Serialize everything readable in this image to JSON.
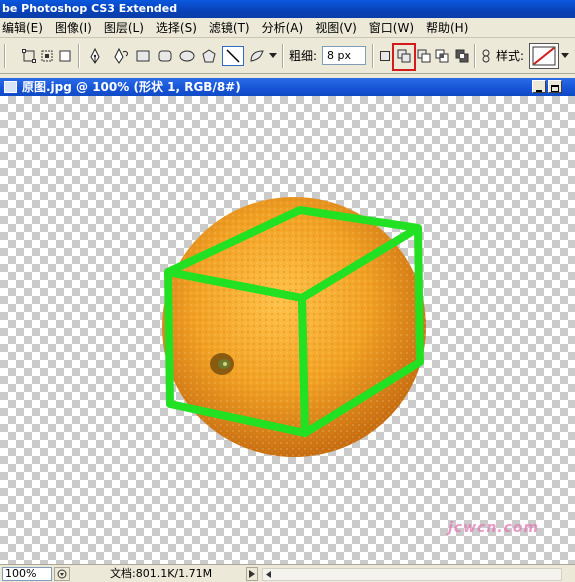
{
  "app": {
    "title": "be Photoshop CS3 Extended"
  },
  "menu": [
    {
      "label": "编辑(E)"
    },
    {
      "label": "图像(I)"
    },
    {
      "label": "图层(L)"
    },
    {
      "label": "选择(S)"
    },
    {
      "label": "滤镜(T)"
    },
    {
      "label": "分析(A)"
    },
    {
      "label": "视图(V)"
    },
    {
      "label": "窗口(W)"
    },
    {
      "label": "帮助(H)"
    }
  ],
  "options_bar": {
    "weight_label": "粗细:",
    "weight_value": "8 px",
    "style_label": "样式:",
    "selected_mode_icon": "add-to-shape-area-icon",
    "highlight_color": "#d41b1b"
  },
  "document": {
    "title": "原图.jpg @ 100% (形状 1, RGB/8#)"
  },
  "watermark": {
    "text": "jcwcn.com"
  },
  "status_bar": {
    "zoom": "100%",
    "doc_info": "文档:801.1K/1.71M"
  },
  "colors": {
    "shape_stroke": "#22e022",
    "orange": "#f0a020",
    "title_blue": "#0842b6"
  }
}
